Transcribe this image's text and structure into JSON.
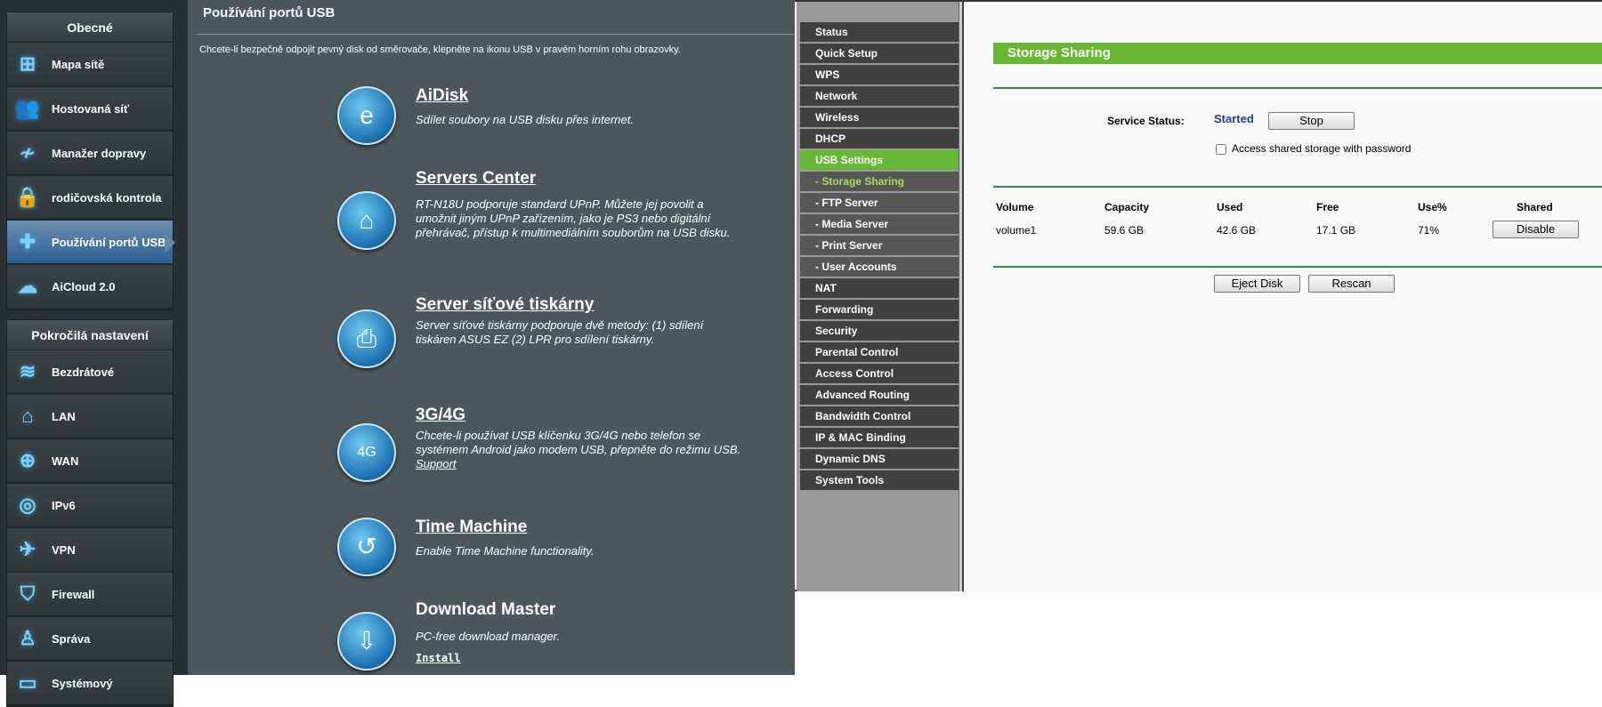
{
  "asus": {
    "sidebar": {
      "general_header": "Obecné",
      "general_items": [
        {
          "label": "Mapa sítě",
          "icon": "network-map-icon"
        },
        {
          "label": "Hostovaná síť",
          "icon": "guest-network-icon"
        },
        {
          "label": "Manažer dopravy",
          "icon": "traffic-manager-icon"
        },
        {
          "label": "rodičovská kontrola",
          "icon": "lock-icon"
        },
        {
          "label": "Používání portů USB",
          "icon": "puzzle-icon"
        },
        {
          "label": "AiCloud 2.0",
          "icon": "cloud-icon"
        }
      ],
      "advanced_header": "Pokročilá nastavení",
      "advanced_items": [
        {
          "label": "Bezdrátové",
          "icon": "wifi-icon"
        },
        {
          "label": "LAN",
          "icon": "home-icon"
        },
        {
          "label": "WAN",
          "icon": "globe-icon"
        },
        {
          "label": "IPv6",
          "icon": "ipv6-icon"
        },
        {
          "label": "VPN",
          "icon": "vpn-icon"
        },
        {
          "label": "Firewall",
          "icon": "shield-icon"
        },
        {
          "label": "Správa",
          "icon": "user-icon"
        },
        {
          "label": "Systémový",
          "icon": "system-log-icon"
        }
      ]
    },
    "title": "Používání portů USB",
    "description": "Chcete-li bezpečně odpojit pevný disk od směrovače, klepněte na ikonu USB v pravém horním rohu obrazovky.",
    "features": {
      "aidisk": {
        "title": "AiDisk",
        "desc": "Sdílet soubory na USB disku přes internet."
      },
      "servers": {
        "title": "Servers Center",
        "desc": "RT-N18U podporuje standard UPnP. Můžete jej povolit a umožnit jiným UPnP zařízením, jako je PS3 nebo digitální přehrávač, přístup k multimediálním souborům na USB disku."
      },
      "printer": {
        "title": "Server síťové tiskárny",
        "desc": "Server síťové tiskárny podporuje dvě metody: (1) sdílení tiskáren ASUS EZ (2) LPR pro sdílení tiskárny."
      },
      "mobile": {
        "title": "3G/4G",
        "desc": "Chcete-li používat USB klíčenku 3G/4G nebo telefon se systémem Android jako modem USB, přepněte do režimu USB.",
        "link": "Support"
      },
      "timemachine": {
        "title": "Time Machine",
        "desc": "Enable Time Machine functionality."
      },
      "download": {
        "title": "Download Master",
        "desc": "PC-free download manager.",
        "link": "Install"
      }
    }
  },
  "tplink": {
    "nav": [
      {
        "label": "Status",
        "type": "main"
      },
      {
        "label": "Quick Setup",
        "type": "main"
      },
      {
        "label": "WPS",
        "type": "main"
      },
      {
        "label": "Network",
        "type": "main"
      },
      {
        "label": "Wireless",
        "type": "main"
      },
      {
        "label": "DHCP",
        "type": "main"
      },
      {
        "label": "USB Settings",
        "type": "on"
      },
      {
        "label": "- Storage Sharing",
        "type": "subon"
      },
      {
        "label": "- FTP Server",
        "type": "sub"
      },
      {
        "label": "- Media Server",
        "type": "sub"
      },
      {
        "label": "- Print Server",
        "type": "sub"
      },
      {
        "label": "- User Accounts",
        "type": "sub"
      },
      {
        "label": "NAT",
        "type": "main"
      },
      {
        "label": "Forwarding",
        "type": "main"
      },
      {
        "label": "Security",
        "type": "main"
      },
      {
        "label": "Parental Control",
        "type": "main"
      },
      {
        "label": "Access Control",
        "type": "main"
      },
      {
        "label": "Advanced Routing",
        "type": "main"
      },
      {
        "label": "Bandwidth Control",
        "type": "main"
      },
      {
        "label": "IP & MAC Binding",
        "type": "main"
      },
      {
        "label": "Dynamic DNS",
        "type": "main"
      },
      {
        "label": "System Tools",
        "type": "main"
      }
    ],
    "header": "Storage Sharing",
    "service_status_label": "Service Status:",
    "service_status_value": "Started",
    "stop_label": "Stop",
    "password_checkbox_label": "Access shared storage with password",
    "password_checked": false,
    "table": {
      "headers": [
        "Volume",
        "Capacity",
        "Used",
        "Free",
        "Use%",
        "Shared"
      ],
      "rows": [
        {
          "volume": "volume1",
          "capacity": "59.6 GB",
          "used": "42.6 GB",
          "free": "17.1 GB",
          "use_pct": "71%",
          "shared_button": "Disable"
        }
      ]
    },
    "eject_label": "Eject Disk",
    "rescan_label": "Rescan",
    "colors": {
      "accent": "#66b832",
      "status": "#1a3d99"
    }
  }
}
